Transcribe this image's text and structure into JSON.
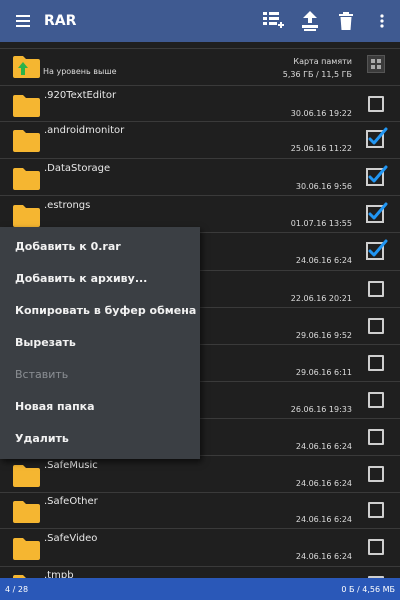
{
  "app": {
    "title": "RAR"
  },
  "toolbar": {
    "icons": [
      "menu-icon",
      "add-to-archive-icon",
      "extract-icon",
      "delete-icon",
      "more-vert-icon"
    ]
  },
  "up_row": {
    "label": "На уровень выше",
    "memory_title": "Карта памяти",
    "memory_value": "5,36 ГБ / 11,5 ГБ"
  },
  "files": [
    {
      "name": ".920TextEditor",
      "date": "30.06.16 19:22",
      "checked": false
    },
    {
      "name": ".androidmonitor",
      "date": "25.06.16 11:22",
      "checked": true
    },
    {
      "name": ".DataStorage",
      "date": "30.06.16 9:56",
      "checked": true
    },
    {
      "name": ".estrongs",
      "date": "01.07.16 13:55",
      "checked": true
    },
    {
      "name": "",
      "date": "24.06.16 6:24",
      "checked": true
    },
    {
      "name": "",
      "date": "22.06.16 20:21",
      "checked": false
    },
    {
      "name": "",
      "date": "29.06.16 9:52",
      "checked": false
    },
    {
      "name": "",
      "date": "29.06.16 6:11",
      "checked": false
    },
    {
      "name": "",
      "date": "26.06.16 19:33",
      "checked": false
    },
    {
      "name": "",
      "date": "24.06.16 6:24",
      "checked": false
    },
    {
      "name": ".SafeMusic",
      "date": "24.06.16 6:24",
      "checked": false
    },
    {
      "name": ".SafeOther",
      "date": "24.06.16 6:24",
      "checked": false
    },
    {
      "name": ".SafeVideo",
      "date": "24.06.16 6:24",
      "checked": false
    },
    {
      "name": ".tmpb",
      "date": "",
      "checked": false
    }
  ],
  "context_menu": {
    "items": [
      {
        "label": "Добавить к 0.rar",
        "enabled": true
      },
      {
        "label": "Добавить к архиву...",
        "enabled": true
      },
      {
        "label": "Копировать в буфер обмена",
        "enabled": true
      },
      {
        "label": "Вырезать",
        "enabled": true
      },
      {
        "label": "Вставить",
        "enabled": false
      },
      {
        "label": "Новая папка",
        "enabled": true
      },
      {
        "label": "Удалить",
        "enabled": true
      }
    ]
  },
  "status": {
    "left": "4 / 28",
    "right": "0 Б / 4,56 МБ"
  },
  "colors": {
    "appbar": "#3f5a91",
    "accent": "#2196f3",
    "folder": "#f5b631",
    "status": "#2a58b8"
  }
}
